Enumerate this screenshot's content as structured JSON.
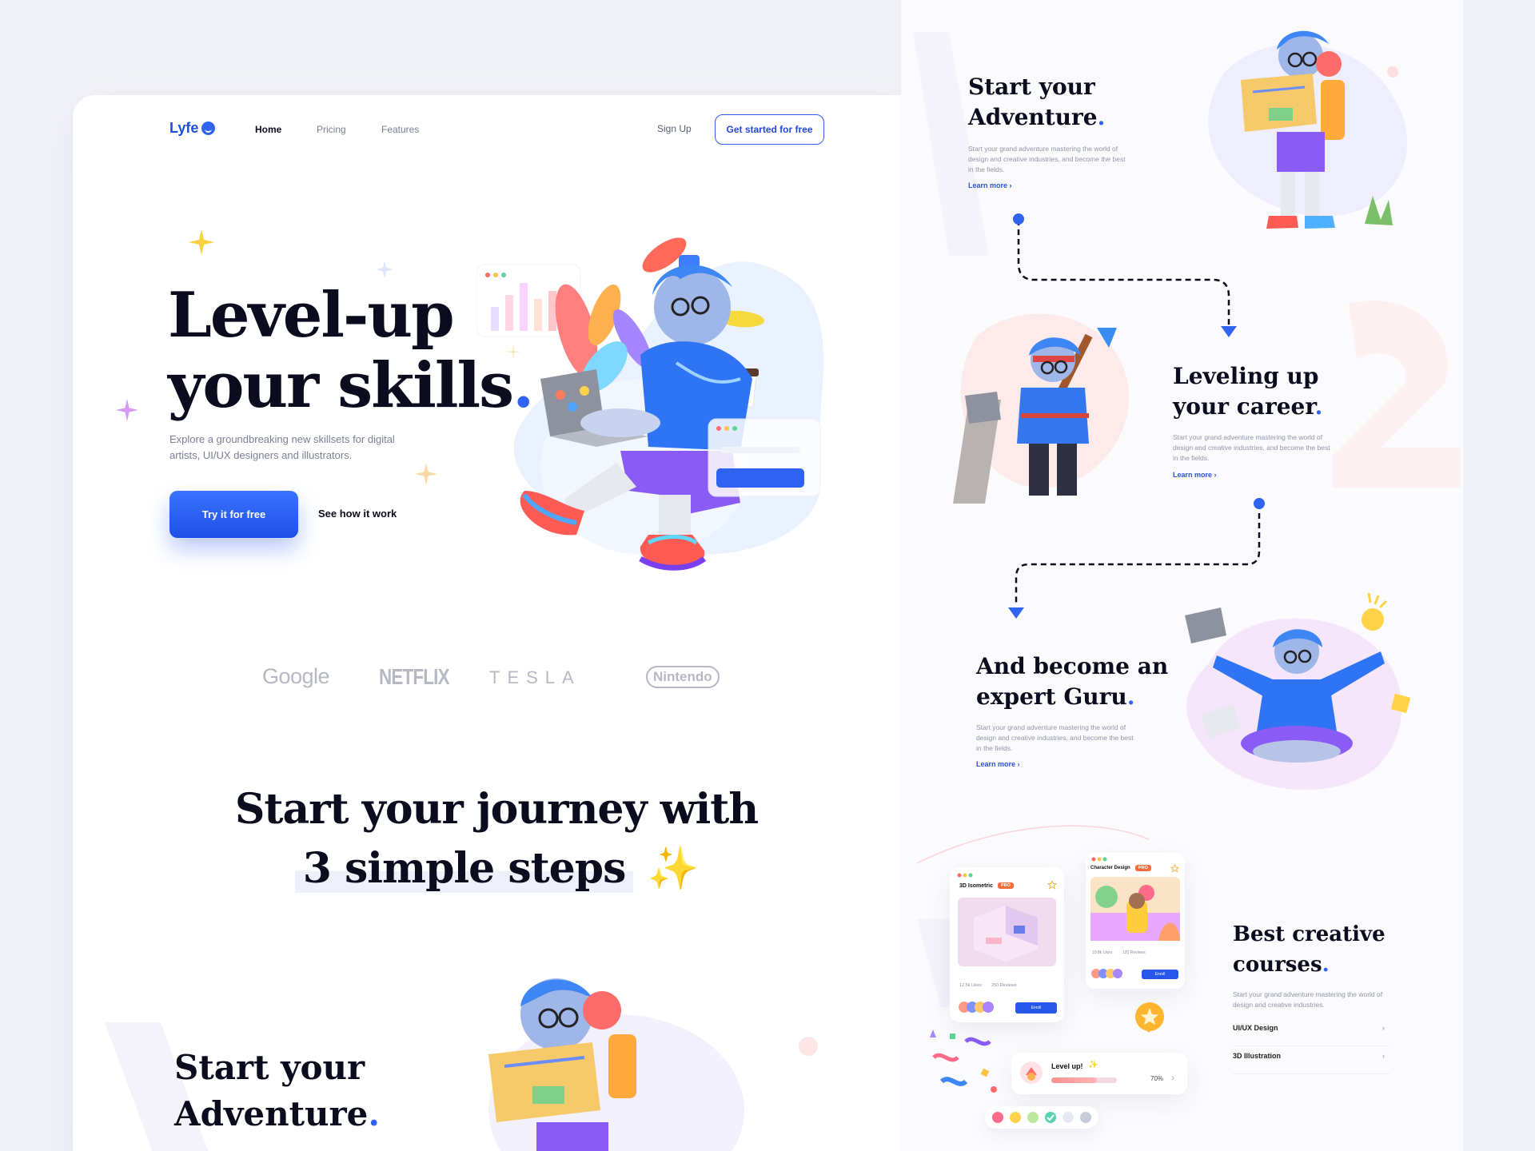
{
  "nav": {
    "logo": "Lyfe",
    "links": [
      "Home",
      "Pricing",
      "Features"
    ],
    "signup": "Sign Up",
    "cta": "Get started for free"
  },
  "hero": {
    "title_line1": "Level-up",
    "title_line2": "your skills",
    "title_dot": ".",
    "description": "Explore a groundbreaking new skillsets for digital artists, UI/UX designers and illustrators.",
    "primary_button": "Try it for free",
    "secondary_button": "See how it work"
  },
  "partners": [
    "Google",
    "NETFLIX",
    "TESLA",
    "Nintendo"
  ],
  "journey": {
    "title_line1": "Start your journey with",
    "title_line2": "3 simple steps",
    "sparkle": "✨"
  },
  "steps": [
    {
      "title_line1": "Start your",
      "title_line2": "Adventure",
      "description": "Start your grand adventure mastering the world of design and creative industries, and become the best in the fields.",
      "link": "Learn more"
    },
    {
      "title_line1": "Leveling up",
      "title_line2": "your career",
      "description": "Start your grand adventure mastering the world of design and creative industries, and become the best in the fields.",
      "link": "Learn more"
    },
    {
      "title_line1": "And become an",
      "title_line2": "expert Guru",
      "description": "Start your grand adventure mastering the world of design and creative industries, and become the best in the fields.",
      "link": "Learn more"
    }
  ],
  "courses_section": {
    "title_line1": "Best creative",
    "title_line2": "courses",
    "description": "Start your grand adventure mastering the world of design and creative industries.",
    "items": [
      "UI/UX Design",
      "3D Illustration"
    ],
    "card1": {
      "label": "3D Isometric",
      "badge": "PRO",
      "likes": "12.5k Likes",
      "reviews": "250 Reviews",
      "button": "Enroll"
    },
    "card2": {
      "label": "Character Design",
      "badge": "PRO",
      "likes": "10.8k Likes",
      "reviews": "120 Reviews",
      "button": "Enroll"
    },
    "level_up": {
      "label": "Level up!",
      "sparkle": "✨",
      "progress_text": "70%",
      "progress": 0.7
    }
  },
  "colors": {
    "primary": "#2f63f0",
    "text": "#0b0c1e",
    "muted": "#7a7f94",
    "background": "#f1f2f7"
  }
}
